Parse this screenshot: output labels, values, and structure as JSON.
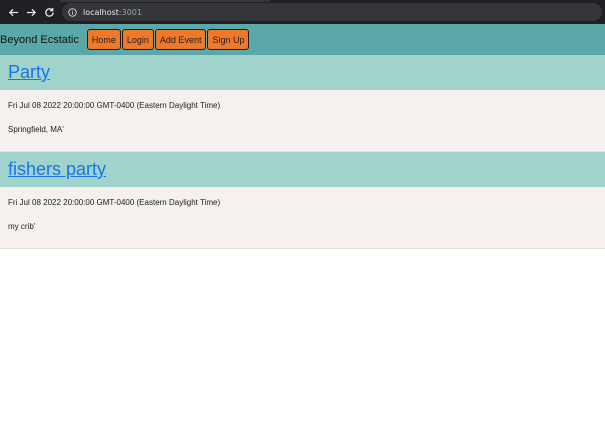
{
  "browser": {
    "url_host": "localhost",
    "url_port": ":3001"
  },
  "navbar": {
    "brand": "Beyond Ecstatic",
    "buttons": [
      "Home",
      "Login",
      "Add Event",
      "Sign Up"
    ]
  },
  "events": [
    {
      "title": "Party",
      "date": "Fri Jul 08 2022 20:00:00 GMT-0400 (Eastern Daylight Time)",
      "location": "Springfield, MA'"
    },
    {
      "title": "fishers party",
      "date": "Fri Jul 08 2022 20:00:00 GMT-0400 (Eastern Daylight Time)",
      "location": "my crib'"
    }
  ],
  "colors": {
    "navbar_bg": "#5aa8a8",
    "button_bg": "#f0782a",
    "event_header_bg": "#a1d3cd",
    "event_body_bg": "#f6f0ee",
    "link": "#1a73e8"
  }
}
